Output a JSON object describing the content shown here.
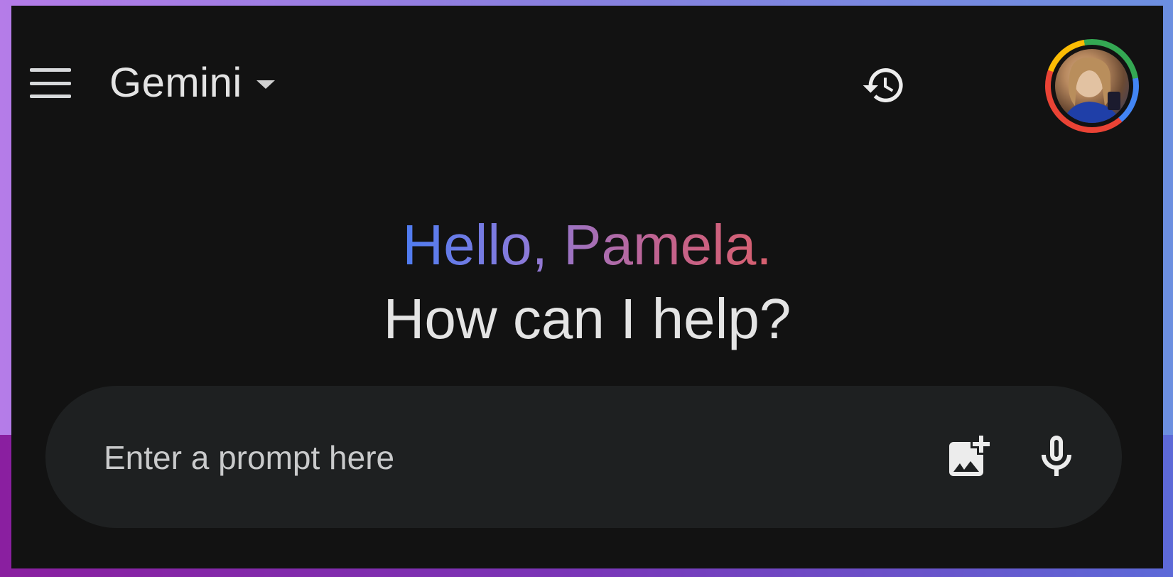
{
  "app": {
    "model_name": "Gemini"
  },
  "header": {
    "menu_icon": "hamburger-menu-icon",
    "dropdown_icon": "caret-down-icon",
    "history_icon": "history-icon",
    "avatar_ring_colors": [
      "#ea4335",
      "#fbbc04",
      "#34a853",
      "#4285f4"
    ]
  },
  "greeting": {
    "line1": "Hello, Pamela.",
    "line2": "How can I help?",
    "gradient_colors": [
      "#4e7cf2",
      "#8e7ad8",
      "#c2628e",
      "#d8606e"
    ]
  },
  "prompt": {
    "placeholder": "Enter a prompt here",
    "value": "",
    "image_icon": "add-image-icon",
    "mic_icon": "microphone-icon"
  },
  "theme": {
    "background": "#121212",
    "prompt_bar": "#1e2021",
    "text": "#e3e3e3"
  }
}
